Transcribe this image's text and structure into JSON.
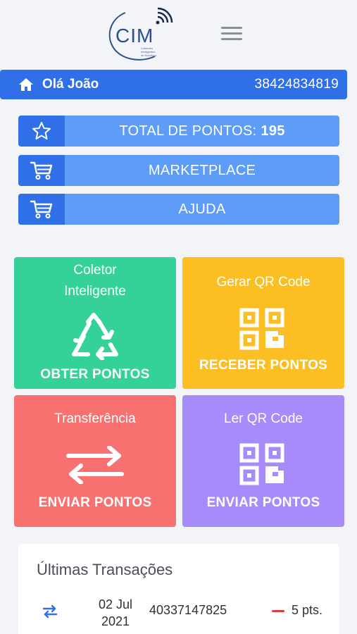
{
  "header": {
    "logo_text": "CIM",
    "logo_subtext": "Coletores Inteligentes de Resíduos"
  },
  "user": {
    "greeting": "Olá João",
    "id": "38424834819"
  },
  "menu": {
    "total_label": "TOTAL DE PONTOS: ",
    "total_value": "195",
    "marketplace_label": "MARKETPLACE",
    "help_label": "AJUDA"
  },
  "tiles": {
    "collector": {
      "title_line1": "Coletor",
      "title_line2": "Inteligente",
      "action": "OBTER PONTOS",
      "color": "#34d199"
    },
    "generate_qr": {
      "title": "Gerar QR Code",
      "action": "RECEBER PONTOS",
      "color": "#fbbf24"
    },
    "transfer": {
      "title": "Transferência",
      "action": "ENVIAR PONTOS",
      "color": "#f87171"
    },
    "read_qr": {
      "title": "Ler QR Code",
      "action": "ENVIAR PONTOS",
      "color": "#a78bfa"
    }
  },
  "transactions": {
    "title": "Últimas Transações",
    "items": [
      {
        "date_line1": "02 Jul",
        "date_line2": "2021",
        "code": "40337147825",
        "points": "5 pts.",
        "type": "debit"
      }
    ]
  },
  "colors": {
    "primary": "#2f6fe8",
    "primary_light": "#5d9cf7",
    "background": "#f2f4f7",
    "debit": "#e23a3a"
  }
}
